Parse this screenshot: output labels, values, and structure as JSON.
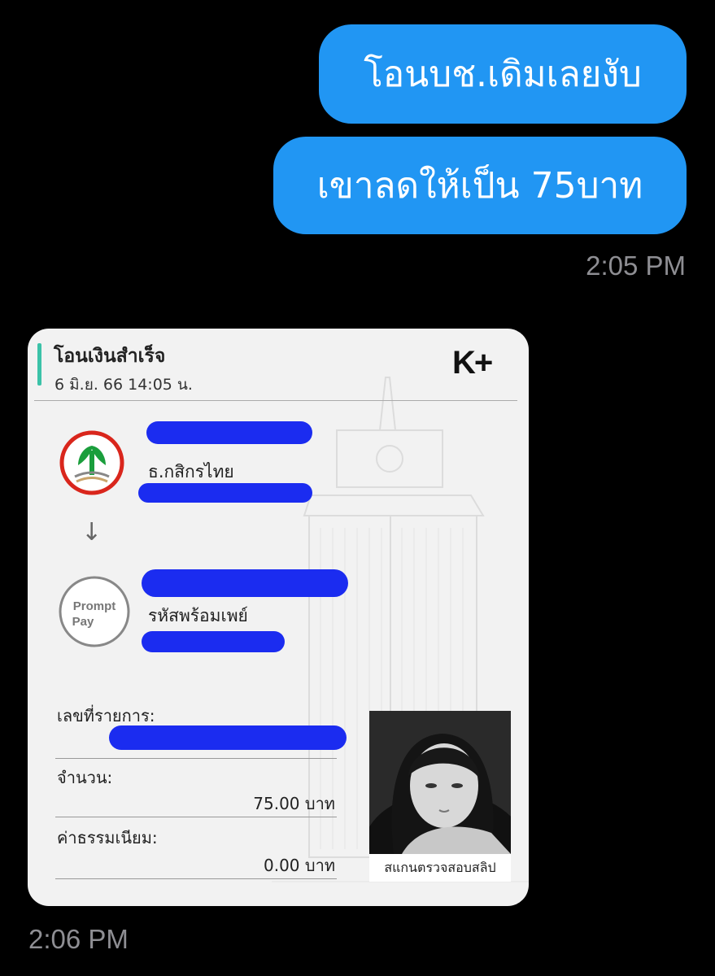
{
  "messages": [
    {
      "text": "โอนบช.เดิมเลยงับ"
    },
    {
      "text": "เขาลดให้เป็น 75บาท"
    }
  ],
  "times": {
    "sent": "2:05 PM",
    "received": "2:06 PM"
  },
  "slip": {
    "title": "โอนเงินสำเร็จ",
    "date": "6 มิ.ย. 66  14:05 น.",
    "app_logo": "K+",
    "from_bank": "ธ.กสิกรไทย",
    "to_service": "รหัสพร้อมเพย์",
    "promptpay_logo": [
      "Prompt",
      "Pay"
    ],
    "ref_label": "เลขที่รายการ:",
    "amount_label": "จำนวน:",
    "amount_value": "75.00 บาท",
    "fee_label": "ค่าธรรมเนียม:",
    "fee_value": "0.00 บาท",
    "qr_caption": "สแกนตรวจสอบสลิป"
  },
  "colors": {
    "bubble": "#2196f3",
    "accent": "#3bc2a8",
    "redaction": "#1b2cf0",
    "kbank_green": "#1a9e3c",
    "kbank_red": "#d9261c"
  }
}
